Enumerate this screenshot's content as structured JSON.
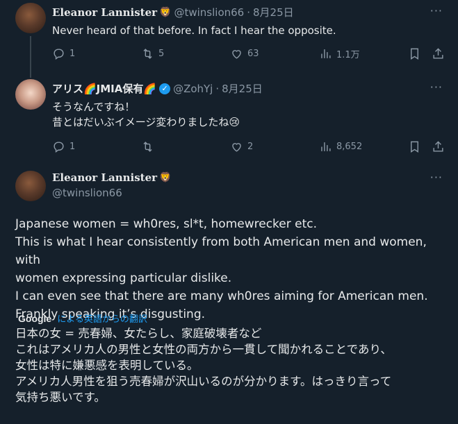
{
  "tweets": [
    {
      "name": "Eleanor Lannister",
      "name_emoji": "🦁",
      "handle": "@twinslion66",
      "date": "8月25日",
      "text": "Never heard of that before. In fact I hear the opposite.",
      "replies": "1",
      "retweets": "5",
      "likes": "63",
      "views": "1.1万"
    },
    {
      "name": "アリス🌈JMIA保有🌈",
      "handle": "@ZohYj",
      "date": "8月25日",
      "text_lines": [
        "そうなんですね！",
        "昔とはだいぶイメージ変わりましたね😢"
      ],
      "replies": "1",
      "retweets": "",
      "likes": "2",
      "views": "8,652"
    }
  ],
  "main_tweet": {
    "name": "Eleanor Lannister",
    "name_emoji": "🦁",
    "handle": "@twinslion66",
    "text_lines": [
      "Japanese women = wh0res, sl*t, homewrecker etc.",
      "This is what I hear consistently from both American men and women, with",
      "women expressing particular dislike.",
      "I can even see that there are many wh0res aiming for American men.",
      "Frankly speaking it’s disgusting."
    ],
    "translate_brand": "Google",
    "translate_label": "による英語からの翻訳",
    "translated_lines": [
      "日本の女 = 売春婦、女たらし、家庭破壊者など",
      "これはアメリカ人の男性と女性の両方から一貫して聞かれることであり、",
      "女性は特に嫌悪感を表明している。",
      "アメリカ人男性を狙う売春婦が沢山いるのが分かります。はっきり言って",
      "気持ち悪いです。"
    ]
  },
  "ui": {
    "more_glyph": "···",
    "dot": "·"
  }
}
